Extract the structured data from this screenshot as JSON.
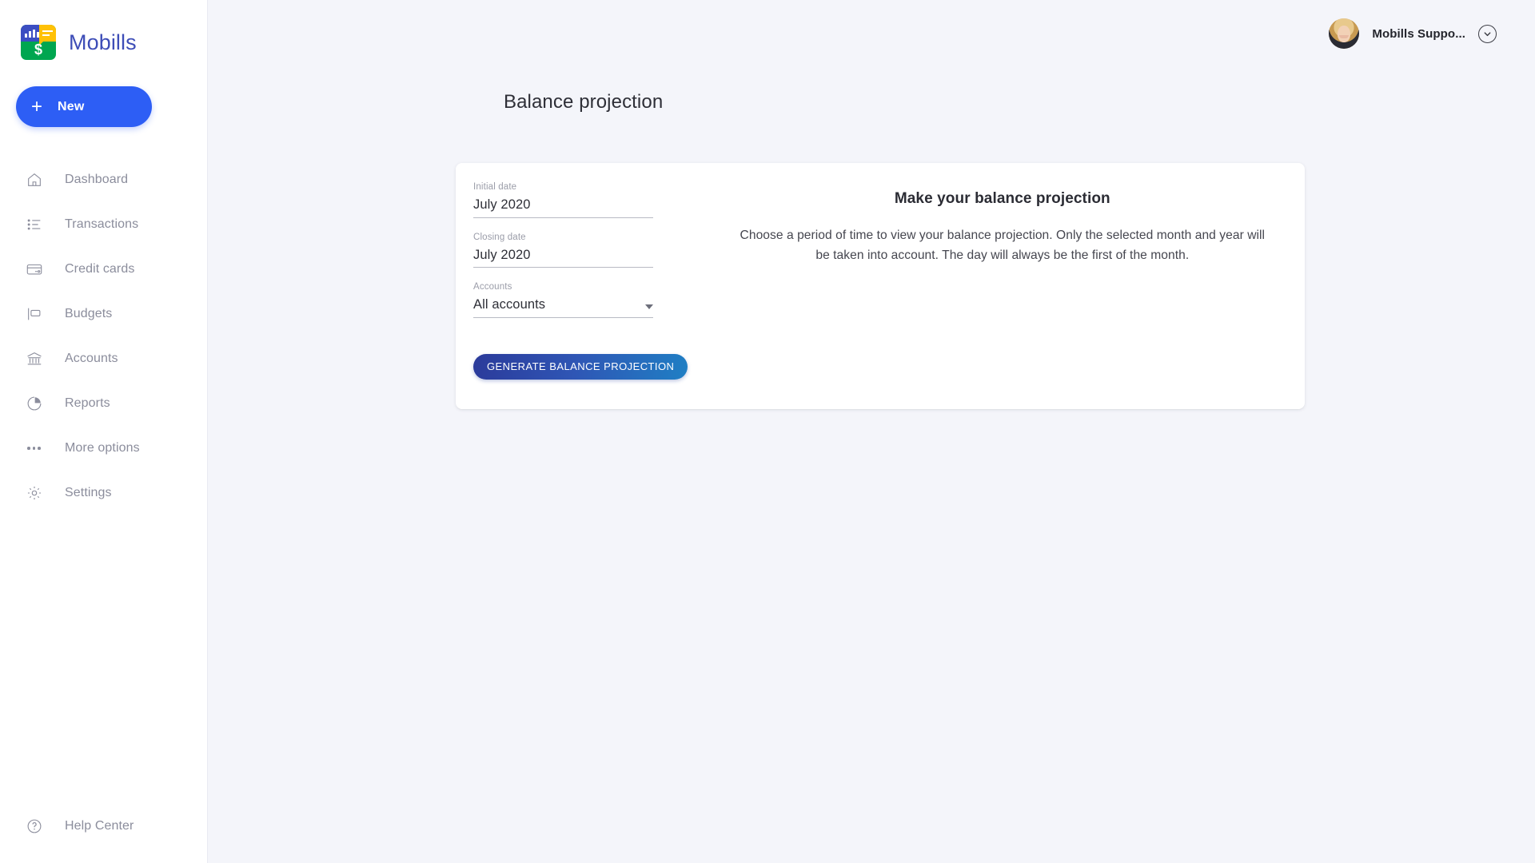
{
  "brand": {
    "name": "Mobills",
    "logo_icon": "mobills-logo-icon",
    "dollar_glyph": "$"
  },
  "colors": {
    "brand_indigo": "#3d4db7",
    "new_button_blue": "#2d5ef5",
    "logo_green": "#00a650",
    "logo_blue": "#3c4ec2",
    "logo_yellow": "#ffc107",
    "page_background": "#f4f5fa",
    "card_background": "#ffffff",
    "muted_text": "#8b8d9c",
    "generate_gradient_from": "#2b3a9a",
    "generate_gradient_to": "#1f7fc4"
  },
  "sidebar": {
    "new_button": {
      "label": "New",
      "icon": "plus-icon"
    },
    "items": [
      {
        "label": "Dashboard",
        "icon": "home-icon"
      },
      {
        "label": "Transactions",
        "icon": "list-icon"
      },
      {
        "label": "Credit cards",
        "icon": "credit-card-icon"
      },
      {
        "label": "Budgets",
        "icon": "flag-icon"
      },
      {
        "label": "Accounts",
        "icon": "bank-icon"
      },
      {
        "label": "Reports",
        "icon": "pie-chart-icon"
      },
      {
        "label": "More options",
        "icon": "ellipsis-icon"
      },
      {
        "label": "Settings",
        "icon": "gear-icon"
      }
    ],
    "footer": {
      "label": "Help Center",
      "icon": "question-mark-circle-icon"
    }
  },
  "topbar": {
    "user_name": "Mobills Suppo...",
    "avatar": "user-avatar-photo",
    "dropdown_icon": "chevron-down-icon"
  },
  "main": {
    "page_title": "Balance projection"
  },
  "form": {
    "fields": [
      {
        "label": "Initial date",
        "value": "July 2020",
        "type": "month-picker"
      },
      {
        "label": "Closing date",
        "value": "July 2020",
        "type": "month-picker"
      },
      {
        "label": "Accounts",
        "value": "All accounts",
        "type": "select",
        "icon": "caret-down-icon"
      }
    ],
    "submit_label": "GENERATE BALANCE PROJECTION"
  },
  "info_panel": {
    "title": "Make your balance projection",
    "text": "Choose a period of time to view your balance projection. Only the selected month and year will be taken into account. The day will always be the first of the month."
  }
}
